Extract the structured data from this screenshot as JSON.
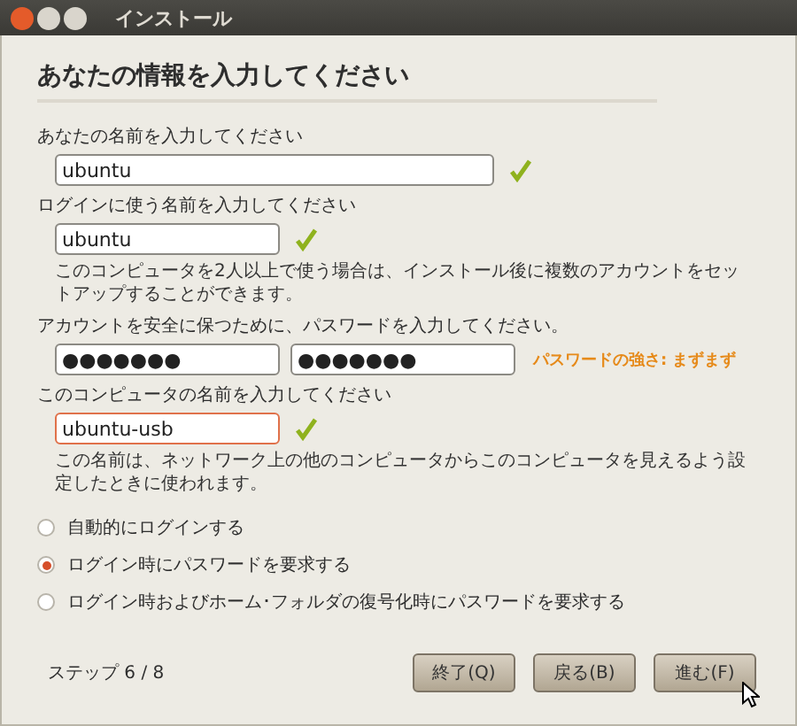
{
  "window": {
    "title": "インストール"
  },
  "heading": "あなたの情報を入力してください",
  "full_name": {
    "label": "あなたの名前を入力してください",
    "value": "ubuntu",
    "valid": true
  },
  "login_name": {
    "label": "ログインに使う名前を入力してください",
    "value": "ubuntu",
    "valid": true,
    "note": "このコンピュータを2人以上で使う場合は、インストール後に複数のアカウントをセットアップすることができます。"
  },
  "password": {
    "label": "アカウントを安全に保つために、パスワードを入力してください。",
    "value": "●●●●●●●",
    "confirm": "●●●●●●●",
    "strength": "パスワードの強さ: まずまず"
  },
  "computer_name": {
    "label": "このコンピュータの名前を入力してください",
    "value": "ubuntu-usb",
    "valid": true,
    "focused": true,
    "note": "この名前は、ネットワーク上の他のコンピュータからこのコンピュータを見えるよう設定したときに使われます。"
  },
  "login_options": [
    {
      "label": "自動的にログインする",
      "selected": false
    },
    {
      "label": "ログイン時にパスワードを要求する",
      "selected": true
    },
    {
      "label": "ログイン時およびホーム･フォルダの復号化時にパスワードを要求する",
      "selected": false
    }
  ],
  "step": "ステップ 6 / 8",
  "buttons": [
    "終了(Q)",
    "戻る(B)",
    "進む(F)"
  ]
}
